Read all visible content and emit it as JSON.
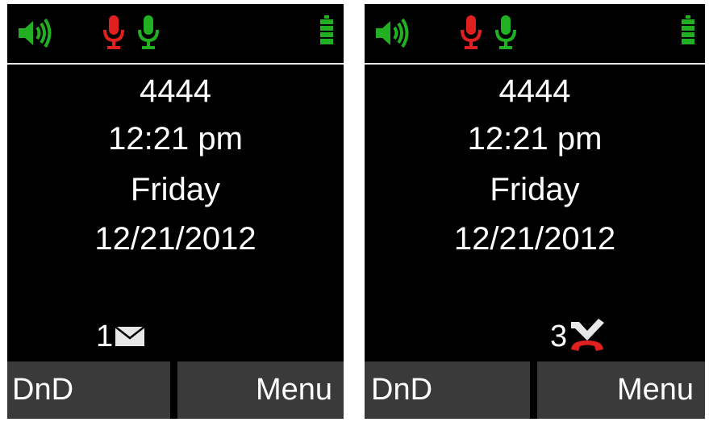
{
  "screens": [
    {
      "status": {
        "speaker_icon": "speaker-volume-icon",
        "mic_muted_icon": "microphone-red-icon",
        "mic_active_icon": "microphone-green-icon",
        "battery_icon": "battery-full-icon"
      },
      "extension": "4444",
      "time": "12:21 pm",
      "day": "Friday",
      "date": "12/21/2012",
      "notification": {
        "count": "1",
        "icon": "envelope-icon"
      },
      "softkeys": {
        "left": "DnD",
        "right": "Menu"
      }
    },
    {
      "status": {
        "speaker_icon": "speaker-volume-icon",
        "mic_muted_icon": "microphone-red-icon",
        "mic_active_icon": "microphone-green-icon",
        "battery_icon": "battery-full-icon"
      },
      "extension": "4444",
      "time": "12:21 pm",
      "day": "Friday",
      "date": "12/21/2012",
      "notification": {
        "count": "3",
        "icon": "missed-call-icon"
      },
      "softkeys": {
        "left": "DnD",
        "right": "Menu"
      }
    }
  ],
  "colors": {
    "screen_background": "#000000",
    "text": "#ffffff",
    "softkey_background": "#3a3a3a",
    "status_green": "#22b022",
    "status_red": "#e02020",
    "separator": "#e8e8e8"
  }
}
